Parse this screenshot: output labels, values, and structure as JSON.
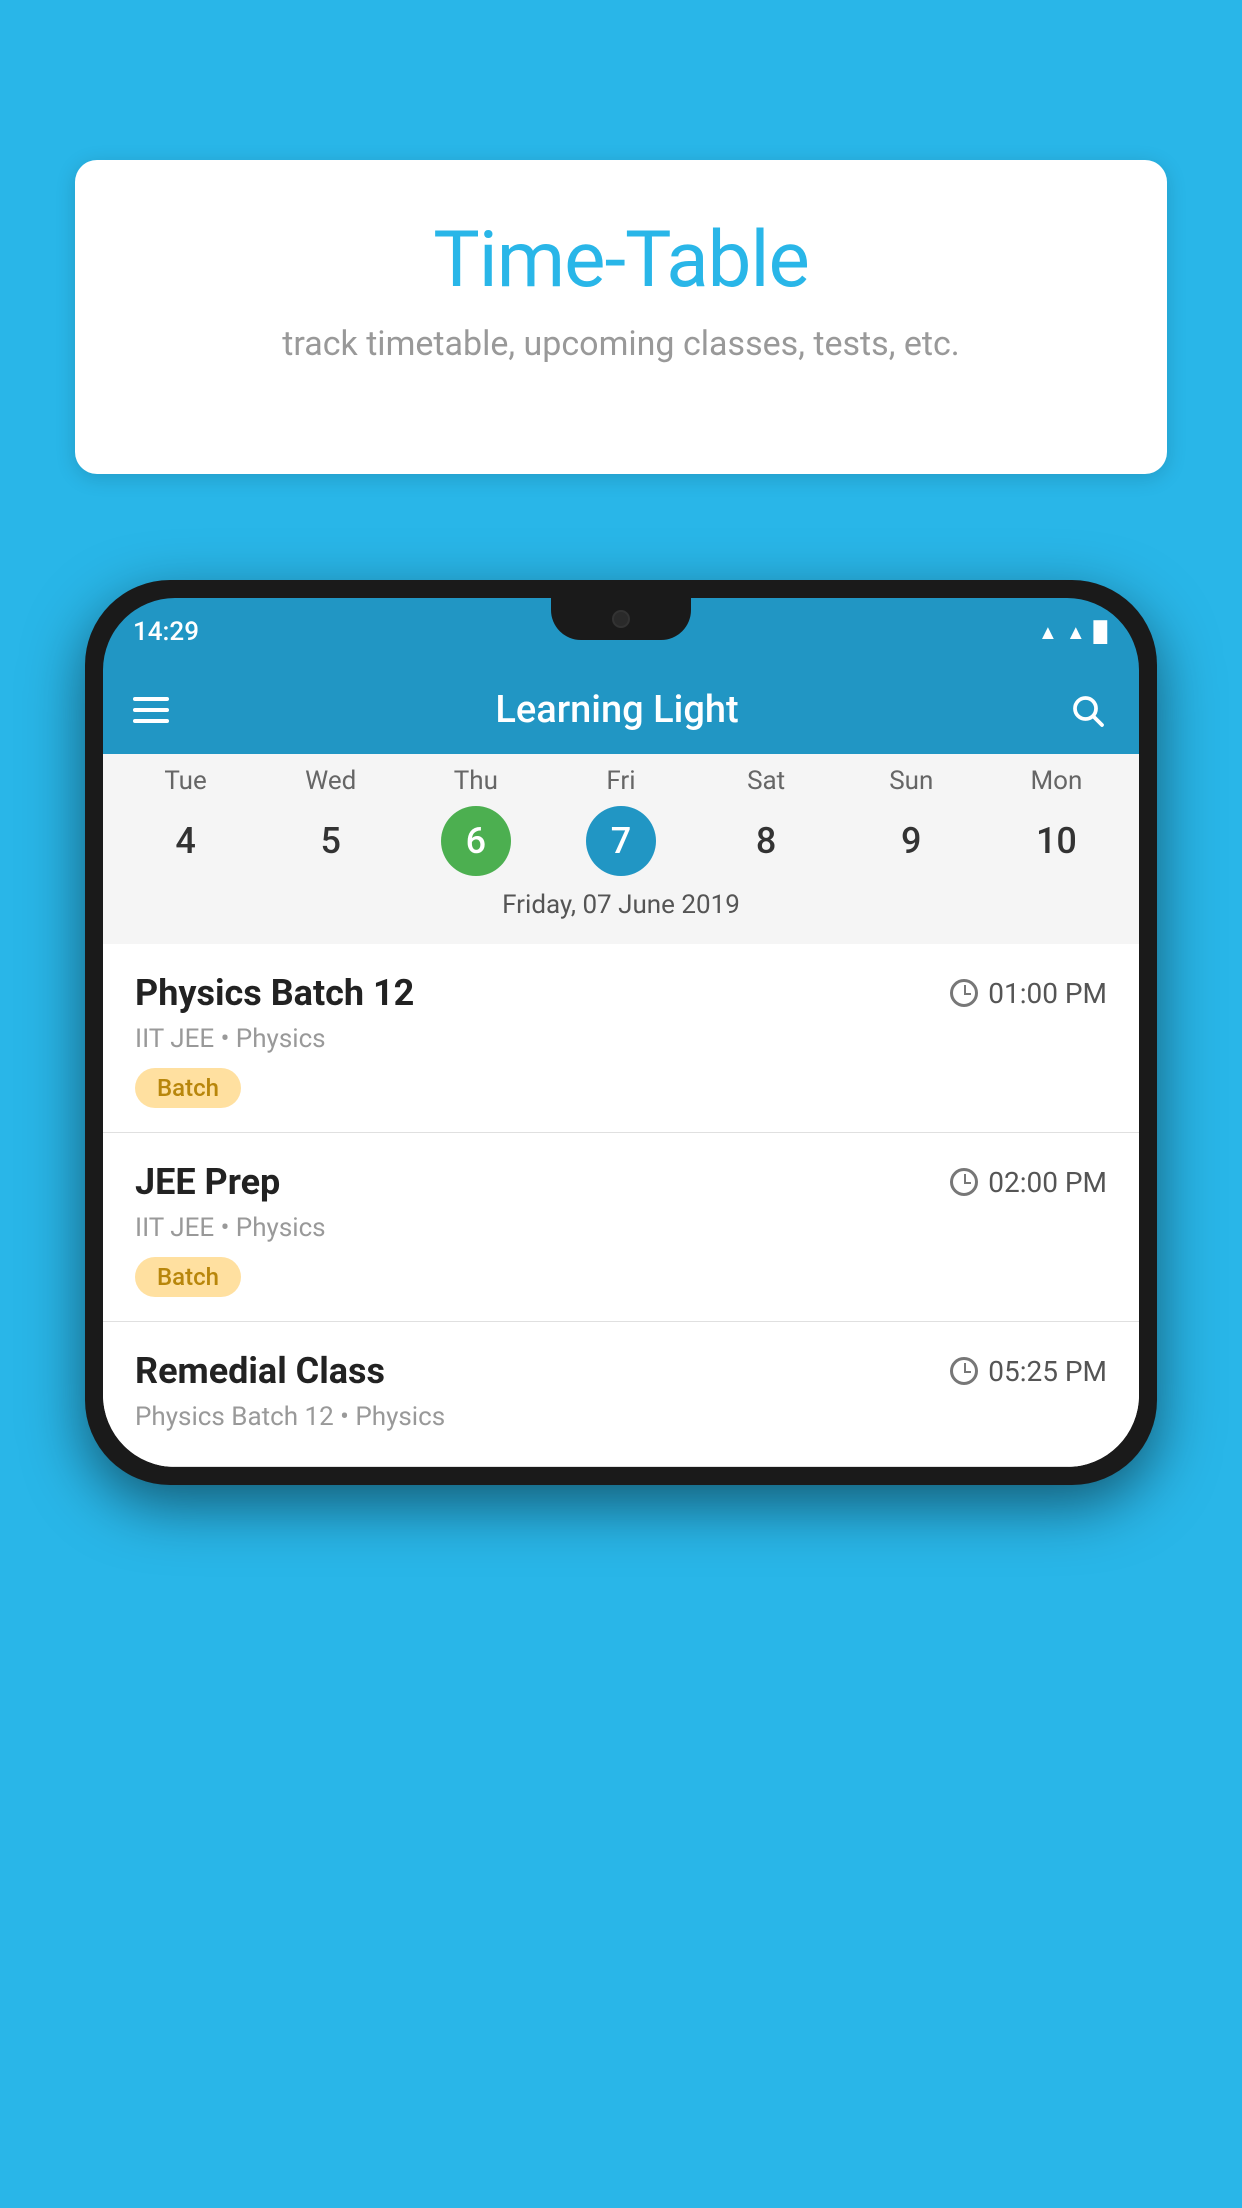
{
  "background_color": "#29b6e8",
  "bubble": {
    "title": "Time-Table",
    "subtitle": "track timetable, upcoming classes, tests, etc."
  },
  "phone": {
    "status_time": "14:29",
    "app_name": "Learning Light",
    "calendar": {
      "days": [
        {
          "name": "Tue",
          "num": "4",
          "state": "normal"
        },
        {
          "name": "Wed",
          "num": "5",
          "state": "normal"
        },
        {
          "name": "Thu",
          "num": "6",
          "state": "today"
        },
        {
          "name": "Fri",
          "num": "7",
          "state": "selected"
        },
        {
          "name": "Sat",
          "num": "8",
          "state": "normal"
        },
        {
          "name": "Sun",
          "num": "9",
          "state": "normal"
        },
        {
          "name": "Mon",
          "num": "10",
          "state": "normal"
        }
      ],
      "selected_date_label": "Friday, 07 June 2019"
    },
    "schedule": [
      {
        "title": "Physics Batch 12",
        "time": "01:00 PM",
        "subtitle": "IIT JEE • Physics",
        "tag": "Batch"
      },
      {
        "title": "JEE Prep",
        "time": "02:00 PM",
        "subtitle": "IIT JEE • Physics",
        "tag": "Batch"
      },
      {
        "title": "Remedial Class",
        "time": "05:25 PM",
        "subtitle": "Physics Batch 12 • Physics",
        "tag": null
      }
    ]
  }
}
